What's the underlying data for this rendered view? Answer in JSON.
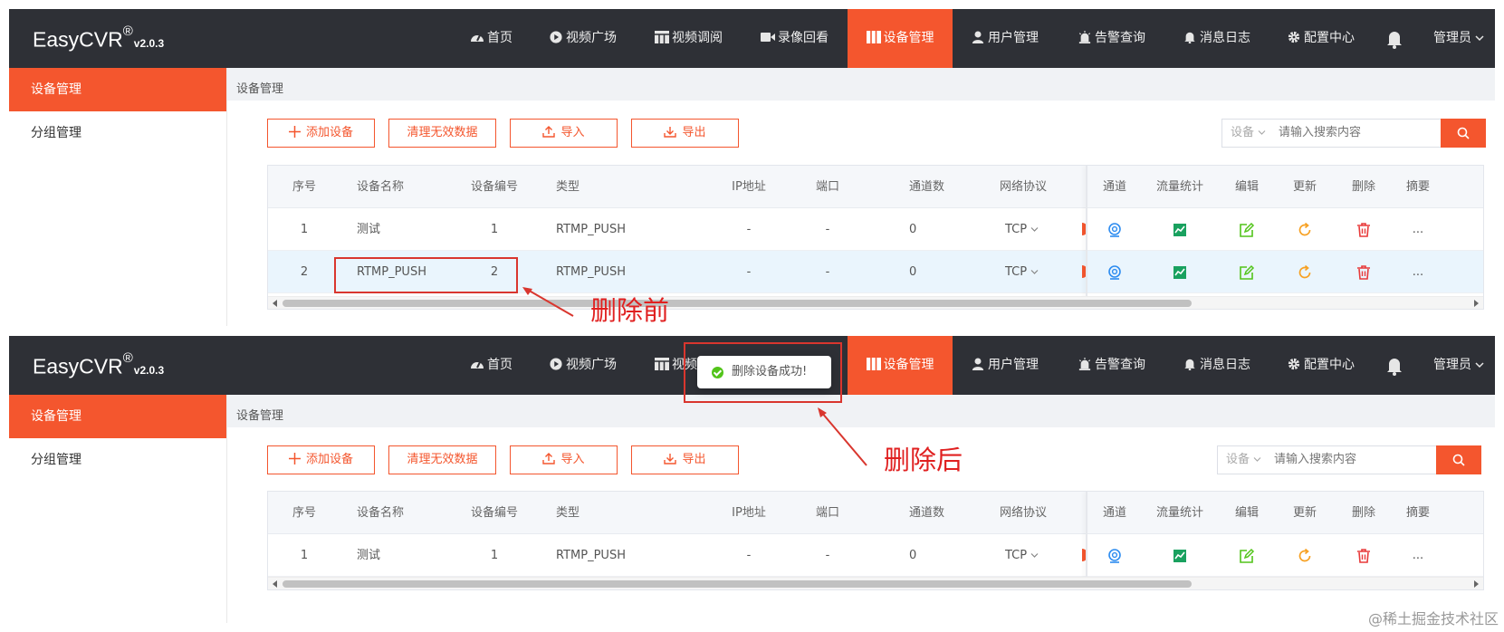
{
  "app": {
    "logo_name": "EasyCVR",
    "logo_mark": "®",
    "version": "v2.0.3"
  },
  "nav": {
    "items": [
      {
        "label": "首页",
        "icon": "dashboard-icon"
      },
      {
        "label": "视频广场",
        "icon": "play-icon"
      },
      {
        "label": "视频调阅",
        "icon": "grid-icon"
      },
      {
        "label": "录像回看",
        "icon": "video-camera-icon"
      },
      {
        "label": "设备管理",
        "icon": "device-icon",
        "active": true
      },
      {
        "label": "用户管理",
        "icon": "user-icon"
      },
      {
        "label": "告警查询",
        "icon": "alarm-icon"
      },
      {
        "label": "消息日志",
        "icon": "bell-icon"
      },
      {
        "label": "配置中心",
        "icon": "gear-icon"
      }
    ],
    "admin_label": "管理员"
  },
  "sidebar": {
    "items": [
      {
        "label": "设备管理",
        "active": true
      },
      {
        "label": "分组管理"
      }
    ]
  },
  "breadcrumb": "设备管理",
  "toolbar": {
    "add_label": "添加设备",
    "clean_label": "清理无效数据",
    "import_label": "导入",
    "export_label": "导出",
    "search_select": "设备",
    "search_placeholder": "请输入搜索内容"
  },
  "table": {
    "columns": [
      "序号",
      "设备名称",
      "设备编号",
      "类型",
      "IP地址",
      "端口",
      "通道数",
      "网络协议",
      "通道",
      "流量统计",
      "编辑",
      "更新",
      "删除",
      "摘要"
    ],
    "rows_before": [
      {
        "index": "1",
        "name": "测试",
        "code": "1",
        "type": "RTMP_PUSH",
        "ip": "-",
        "port": "-",
        "channels": "0",
        "protocol": "TCP",
        "summary": "..."
      },
      {
        "index": "2",
        "name": "RTMP_PUSH",
        "code": "2",
        "type": "RTMP_PUSH",
        "ip": "-",
        "port": "-",
        "channels": "0",
        "protocol": "TCP",
        "summary": "..."
      }
    ],
    "rows_after": [
      {
        "index": "1",
        "name": "测试",
        "code": "1",
        "type": "RTMP_PUSH",
        "ip": "-",
        "port": "-",
        "channels": "0",
        "protocol": "TCP",
        "summary": "..."
      }
    ]
  },
  "toast": {
    "message": "删除设备成功!"
  },
  "annotations": {
    "before": "删除前",
    "after": "删除后"
  },
  "watermark": "@稀土掘金技术社区",
  "colors": {
    "accent": "#f4562e",
    "navbar": "#2e3036",
    "annotation": "#e02020",
    "success": "#52c41a"
  }
}
